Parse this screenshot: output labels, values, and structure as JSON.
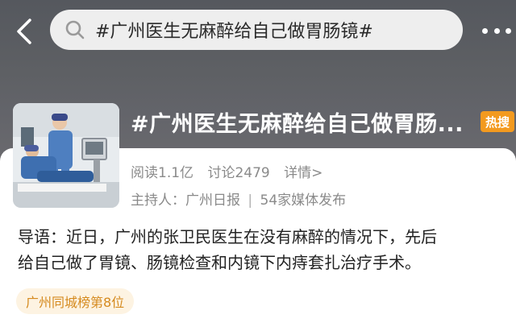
{
  "search": {
    "query": "#广州医生无麻醉给自己做胃肠镜#"
  },
  "topic": {
    "title": "#广州医生无麻醉给自己做胃肠...",
    "hot_badge": "热搜",
    "reads": "阅读1.1亿",
    "discussions": "讨论2479",
    "details_link": "详情>",
    "host_label": "主持人：广州日报",
    "separator": "|",
    "media_count": "54家媒体发布"
  },
  "intro": {
    "line1": "导语：近日，广州的张卫民医生在没有麻醉的情况下，先后",
    "line2": "给自己做了胃镜、肠镜检查和内镜下内痔套扎治疗手术。"
  },
  "rank_badge": "广州同城榜第8位",
  "colors": {
    "header": "#5e6064",
    "hot_badge": "#f39a1f",
    "rank_badge_bg": "#fdf3e2",
    "rank_badge_text": "#d58a1e"
  },
  "icons": [
    "back-arrow-icon",
    "search-icon",
    "more-icon"
  ]
}
